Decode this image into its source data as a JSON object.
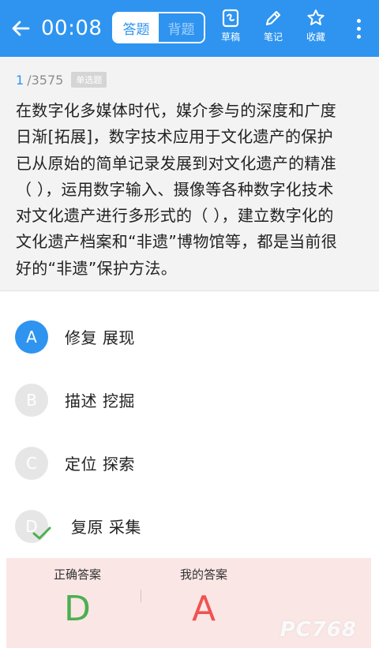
{
  "header": {
    "timer": "00:08",
    "mode_tabs": [
      {
        "label": "答题",
        "active": true
      },
      {
        "label": "背题",
        "active": false
      }
    ],
    "tools": {
      "draft_label": "草稿",
      "note_label": "笔记",
      "favorite_label": "收藏"
    },
    "accent_color": "#2e94f0"
  },
  "question": {
    "index": "1",
    "total": "/3575",
    "type_badge": "单选题",
    "lines": [
      "在数字化多媒体时代，媒介参与的深度和广度",
      "日渐[拓展]，数字技术应用于文化遗产的保护",
      "已从原始的简单记录发展到对文化遗产的精准",
      "（ ），运用数字输入、摄像等各种数字化技术",
      "对文化遗产进行多形式的（ ），建立数字化的",
      "文化遗产档案和“非遗”博物馆等，都是当前很",
      "好的“非遗”保护方法。"
    ]
  },
  "options": [
    {
      "letter": "A",
      "text": "修复 展现",
      "state": "selected"
    },
    {
      "letter": "B",
      "text": "描述 挖掘",
      "state": "idle"
    },
    {
      "letter": "C",
      "text": "定位 探索",
      "state": "idle"
    },
    {
      "letter": "D",
      "text": "复原 采集",
      "state": "correct"
    }
  ],
  "result": {
    "correct_label": "正确答案",
    "correct_value": "D",
    "mine_label": "我的答案",
    "mine_value": "A",
    "correct_color": "#4caf50",
    "wrong_color": "#ef5350"
  },
  "watermark": "PC768"
}
